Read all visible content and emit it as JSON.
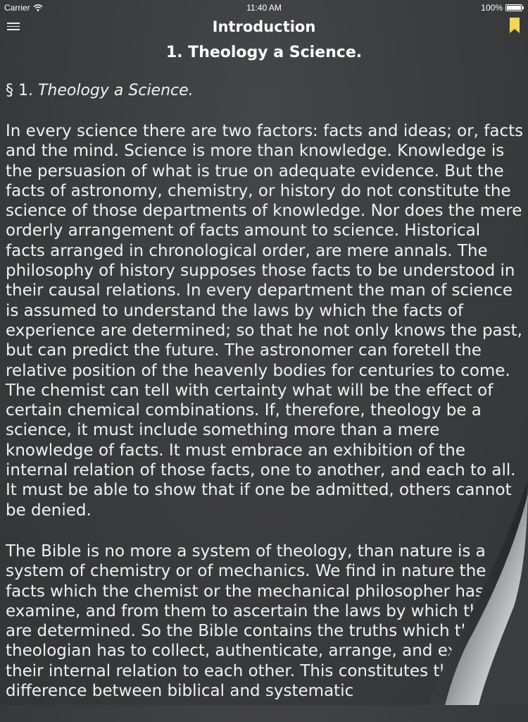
{
  "status_bar": {
    "carrier": "Carrier",
    "time": "11:40 AM",
    "battery": "100%"
  },
  "nav": {
    "title": "Introduction",
    "menu_icon": "hamburger-menu-icon",
    "bookmark_icon": "bookmark-icon"
  },
  "chapter": {
    "title": "1. Theology a Science."
  },
  "section": {
    "number": "§ 1.",
    "title": "Theology a Science."
  },
  "paragraphs": [
    "In every science there are two factors: facts and ideas; or, facts and the mind. Science is more than knowledge. Knowledge is the persuasion of what is true on adequate evidence. But the facts of astronomy, chemistry, or history do not constitute the science of those departments of knowledge. Nor does the mere orderly arrangement of facts amount to science. Historical facts arranged in chronological order, are mere annals. The philosophy of history supposes those facts to be understood in their causal relations. In every department the man of science is assumed to understand the laws by which the facts of experience are determined; so that he not only knows the past, but can predict the future. The astronomer can foretell the relative position of the heavenly bodies for centuries to come. The chemist can tell with certainty what will be the effect of certain chemical combinations. If, therefore, theology be a science, it must include something more than a mere knowledge of facts. It must embrace an exhibition of the internal relation of those facts, one to another, and each to all. It must be able to show that if one be admitted, others cannot be denied.",
    "The Bible is no more a system of theology, than nature is a system of chemistry or of mechanics. We find in nature the facts which the chemist or the mechanical philosopher has to examine, and from them to ascertain the laws by which they are determined. So the Bible contains the truths which the theologian has to collect, authenticate, arrange, and exhibit in their internal relation to each other. This constitutes the difference between biblical and systematic"
  ],
  "colors": {
    "background": "#3b3c3e",
    "text": "#f1f1f1",
    "bookmark": "#f2d65a"
  }
}
